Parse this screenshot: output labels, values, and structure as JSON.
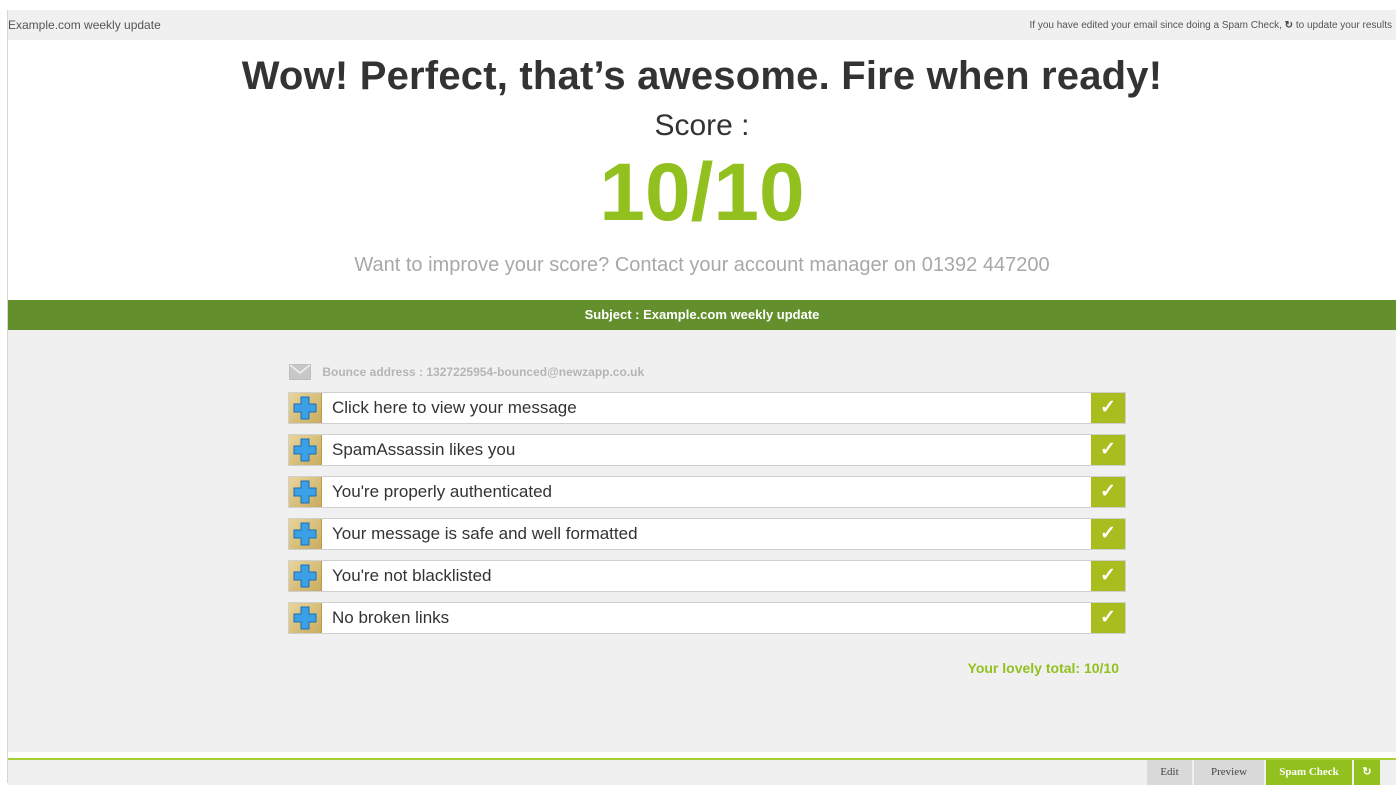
{
  "topbar": {
    "title": "Example.com weekly update",
    "notice_before": "If you have edited your email since doing a Spam Check,",
    "notice_after": "to update your results",
    "refresh_icon": "refresh-icon"
  },
  "result": {
    "headline": "Wow! Perfect, that’s awesome. Fire when ready!",
    "score_label": "Score :",
    "score_value": "10/10",
    "improve_text": "Want to improve your score? Contact your account manager on 01392 447200"
  },
  "subject": {
    "text": "Subject : Example.com weekly update"
  },
  "bounce": {
    "icon": "envelope-icon",
    "text": "Bounce address : 1327225954-bounced@newzapp.co.uk"
  },
  "checks": [
    {
      "label": "Click here to view your message",
      "status": "✓"
    },
    {
      "label": "SpamAssassin likes you",
      "status": "✓"
    },
    {
      "label": "You're properly authenticated",
      "status": "✓"
    },
    {
      "label": "Your message is safe and well formatted",
      "status": "✓"
    },
    {
      "label": "You're not blacklisted",
      "status": "✓"
    },
    {
      "label": "No broken links",
      "status": "✓"
    }
  ],
  "total": "Your lovely total: 10/10",
  "footer": {
    "edit": "Edit",
    "preview": "Preview",
    "spam_check": "Spam Check",
    "refresh": "↻"
  },
  "colors": {
    "accent_green": "#92c01f",
    "subject_bar": "#638f2d",
    "check_bg": "#a9bd1f"
  }
}
